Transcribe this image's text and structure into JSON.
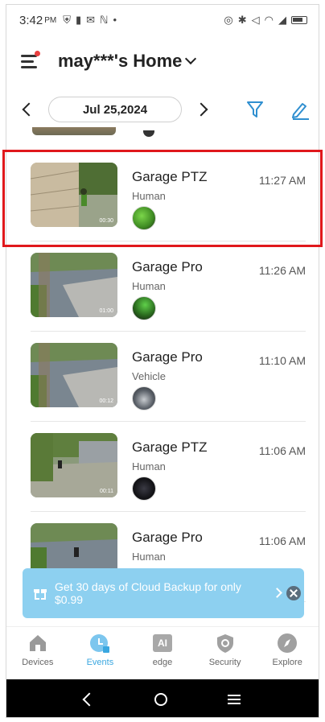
{
  "status_bar": {
    "time": "3:42",
    "ampm": "PM"
  },
  "header": {
    "home_title": "may***'s Home"
  },
  "date_bar": {
    "date": "Jul 25,2024"
  },
  "events": [
    {
      "name": "Garage PTZ",
      "type": "Human",
      "time": "11:27 AM",
      "duration": "00:30"
    },
    {
      "name": "Garage Pro",
      "type": "Human",
      "time": "11:26 AM",
      "duration": "01:00"
    },
    {
      "name": "Garage Pro",
      "type": "Vehicle",
      "time": "11:10 AM",
      "duration": "00:12"
    },
    {
      "name": "Garage PTZ",
      "type": "Human",
      "time": "11:06 AM",
      "duration": "00:11"
    },
    {
      "name": "Garage Pro",
      "type": "Human",
      "time": "11:06 AM",
      "duration": ""
    }
  ],
  "banner": {
    "text": "Get 30 days of Cloud Backup for only $0.99"
  },
  "tabs": [
    {
      "label": "Devices",
      "icon": "house-icon"
    },
    {
      "label": "Events",
      "icon": "events-icon"
    },
    {
      "label": "edge",
      "icon": "ai-edge-icon",
      "icon_text": "AI"
    },
    {
      "label": "Security",
      "icon": "shield-icon"
    },
    {
      "label": "Explore",
      "icon": "compass-icon"
    }
  ],
  "colors": {
    "accent": "#3aa7e0",
    "highlight": "#e0181c",
    "banner": "#8dd0f0"
  }
}
